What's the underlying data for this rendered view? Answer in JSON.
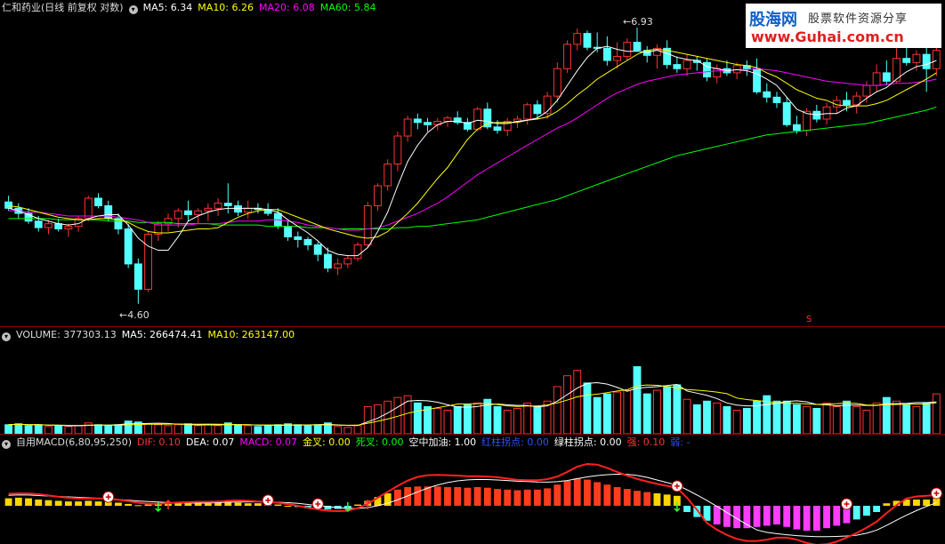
{
  "price_header": {
    "title": "仁和药业(日线 前复权 对数)",
    "ma5": "MA5: 6.34",
    "ma10": "MA10: 6.26",
    "ma20": "MA20: 6.08",
    "ma60": "MA60: 5.84"
  },
  "price_labels": {
    "high": "6.93",
    "low": "4.60",
    "marker": "S"
  },
  "volume_header": {
    "volume": "VOLUME: 377303.13",
    "ma5": "MA5: 266474.41",
    "ma10": "MA10: 263147.00"
  },
  "macd_header": {
    "name": "自用MACD(6,80,95,250)",
    "dif": "DIF: 0.10",
    "dea": "DEA: 0.07",
    "macd": "MACD: 0.07",
    "gold": "金叉: 0.00",
    "death": "死叉: 0.00",
    "refuel": "空中加油: 1.00",
    "red_turn": "红柱拐点: 0.00",
    "green_turn": "绿柱拐点: 0.00",
    "strong": "强: 0.10",
    "weak": "弱: -"
  },
  "watermark": {
    "brand": "股海网",
    "slogan": "股票软件资源分享",
    "url": "www.Guhai.com.cn"
  },
  "colors": {
    "up": "#ff3232",
    "down": "#54ffff",
    "ma5": "#ffffff",
    "ma10": "#ffff00",
    "ma20": "#ff00ff",
    "ma60": "#00ff00",
    "grid": "#8b0000"
  },
  "chart_data": {
    "type": "candlestick",
    "candles": [
      [
        5.35,
        5.4,
        5.28,
        5.3
      ],
      [
        5.3,
        5.34,
        5.22,
        5.26
      ],
      [
        5.26,
        5.3,
        5.18,
        5.2
      ],
      [
        5.2,
        5.24,
        5.12,
        5.15
      ],
      [
        5.15,
        5.21,
        5.1,
        5.18
      ],
      [
        5.18,
        5.22,
        5.12,
        5.14
      ],
      [
        5.14,
        5.18,
        5.08,
        5.16
      ],
      [
        5.16,
        5.24,
        5.12,
        5.22
      ],
      [
        5.22,
        5.4,
        5.2,
        5.38
      ],
      [
        5.38,
        5.42,
        5.3,
        5.32
      ],
      [
        5.32,
        5.36,
        5.2,
        5.22
      ],
      [
        5.22,
        5.26,
        5.1,
        5.14
      ],
      [
        5.14,
        5.18,
        4.85,
        4.88
      ],
      [
        4.88,
        4.92,
        4.6,
        4.7
      ],
      [
        4.7,
        5.12,
        4.68,
        5.1
      ],
      [
        5.1,
        5.2,
        5.05,
        5.18
      ],
      [
        5.18,
        5.26,
        5.12,
        5.22
      ],
      [
        5.22,
        5.3,
        5.15,
        5.28
      ],
      [
        5.28,
        5.36,
        5.2,
        5.25
      ],
      [
        5.25,
        5.3,
        5.18,
        5.28
      ],
      [
        5.28,
        5.34,
        5.2,
        5.3
      ],
      [
        5.3,
        5.38,
        5.24,
        5.34
      ],
      [
        5.34,
        5.5,
        5.26,
        5.32
      ],
      [
        5.32,
        5.36,
        5.24,
        5.27
      ],
      [
        5.27,
        5.36,
        5.22,
        5.3
      ],
      [
        5.3,
        5.34,
        5.26,
        5.29
      ],
      [
        5.29,
        5.34,
        5.24,
        5.26
      ],
      [
        5.26,
        5.3,
        5.14,
        5.16
      ],
      [
        5.16,
        5.2,
        5.05,
        5.08
      ],
      [
        5.08,
        5.12,
        5.0,
        5.06
      ],
      [
        5.06,
        5.08,
        4.98,
        5.02
      ],
      [
        5.02,
        5.04,
        4.9,
        4.95
      ],
      [
        4.95,
        5.0,
        4.82,
        4.85
      ],
      [
        4.85,
        4.92,
        4.8,
        4.88
      ],
      [
        4.88,
        4.94,
        4.85,
        4.92
      ],
      [
        4.92,
        5.04,
        4.9,
        5.02
      ],
      [
        5.02,
        5.35,
        5.0,
        5.32
      ],
      [
        5.32,
        5.5,
        5.28,
        5.48
      ],
      [
        5.48,
        5.7,
        5.44,
        5.66
      ],
      [
        5.66,
        5.94,
        5.6,
        5.9
      ],
      [
        5.9,
        6.08,
        5.85,
        6.05
      ],
      [
        6.05,
        6.1,
        5.96,
        6.02
      ],
      [
        6.02,
        6.06,
        5.94,
        6.0
      ],
      [
        6.0,
        6.06,
        5.95,
        6.03
      ],
      [
        6.03,
        6.08,
        5.98,
        6.06
      ],
      [
        6.06,
        6.12,
        6.0,
        6.02
      ],
      [
        6.02,
        6.06,
        5.94,
        5.96
      ],
      [
        5.96,
        6.16,
        5.94,
        6.14
      ],
      [
        6.14,
        6.2,
        5.96,
        5.98
      ],
      [
        5.98,
        6.04,
        5.92,
        5.95
      ],
      [
        5.95,
        6.06,
        5.9,
        6.03
      ],
      [
        6.03,
        6.08,
        5.97,
        6.05
      ],
      [
        6.05,
        6.2,
        6.0,
        6.18
      ],
      [
        6.18,
        6.22,
        6.05,
        6.1
      ],
      [
        6.1,
        6.3,
        6.05,
        6.26
      ],
      [
        6.26,
        6.58,
        6.2,
        6.52
      ],
      [
        6.52,
        6.8,
        6.48,
        6.76
      ],
      [
        6.76,
        6.92,
        6.7,
        6.87
      ],
      [
        6.87,
        6.9,
        6.7,
        6.73
      ],
      [
        6.73,
        6.88,
        6.68,
        6.72
      ],
      [
        6.72,
        6.84,
        6.55,
        6.6
      ],
      [
        6.6,
        6.78,
        6.52,
        6.64
      ],
      [
        6.64,
        6.82,
        6.6,
        6.78
      ],
      [
        6.78,
        6.93,
        6.7,
        6.7
      ],
      [
        6.7,
        6.74,
        6.58,
        6.65
      ],
      [
        6.65,
        6.76,
        6.52,
        6.72
      ],
      [
        6.72,
        6.8,
        6.52,
        6.56
      ],
      [
        6.56,
        6.64,
        6.48,
        6.52
      ],
      [
        6.52,
        6.66,
        6.45,
        6.6
      ],
      [
        6.6,
        6.64,
        6.5,
        6.58
      ],
      [
        6.58,
        6.62,
        6.4,
        6.44
      ],
      [
        6.44,
        6.56,
        6.38,
        6.52
      ],
      [
        6.52,
        6.6,
        6.45,
        6.48
      ],
      [
        6.48,
        6.58,
        6.42,
        6.55
      ],
      [
        6.55,
        6.6,
        6.45,
        6.52
      ],
      [
        6.52,
        6.62,
        6.28,
        6.3
      ],
      [
        6.3,
        6.38,
        6.2,
        6.25
      ],
      [
        6.25,
        6.3,
        6.15,
        6.2
      ],
      [
        6.2,
        6.25,
        5.98,
        6.0
      ],
      [
        6.0,
        6.08,
        5.92,
        5.95
      ],
      [
        5.95,
        6.15,
        5.9,
        6.12
      ],
      [
        6.12,
        6.18,
        6.02,
        6.05
      ],
      [
        6.05,
        6.2,
        6.0,
        6.16
      ],
      [
        6.16,
        6.26,
        6.1,
        6.22
      ],
      [
        6.22,
        6.3,
        6.12,
        6.18
      ],
      [
        6.18,
        6.3,
        6.1,
        6.26
      ],
      [
        6.26,
        6.4,
        6.2,
        6.36
      ],
      [
        6.36,
        6.56,
        6.3,
        6.48
      ],
      [
        6.48,
        6.6,
        6.36,
        6.4
      ],
      [
        6.4,
        6.72,
        6.38,
        6.62
      ],
      [
        6.62,
        6.82,
        6.55,
        6.58
      ],
      [
        6.58,
        6.7,
        6.5,
        6.66
      ],
      [
        6.66,
        6.74,
        6.3,
        6.52
      ],
      [
        6.52,
        6.76,
        6.45,
        6.7
      ]
    ],
    "ma5": [
      5.3,
      5.28,
      5.25,
      5.22,
      5.2,
      5.18,
      5.17,
      5.18,
      5.22,
      5.24,
      5.25,
      5.25,
      5.17,
      5.07,
      5.01,
      4.98,
      4.98,
      5.08,
      5.2,
      5.24,
      5.27,
      5.29,
      5.3,
      5.3,
      5.3,
      5.3,
      5.29,
      5.27,
      5.21,
      5.16,
      5.11,
      5.05,
      4.98,
      4.95,
      4.94,
      4.94,
      5.0,
      5.12,
      5.27,
      5.48,
      5.68,
      5.82,
      5.93,
      6.0,
      6.03,
      6.03,
      6.01,
      6.04,
      6.03,
      6.01,
      6.01,
      6.03,
      6.04,
      6.06,
      6.12,
      6.22,
      6.36,
      6.5,
      6.63,
      6.72,
      6.74,
      6.71,
      6.69,
      6.69,
      6.68,
      6.7,
      6.67,
      6.63,
      6.61,
      6.6,
      6.54,
      6.52,
      6.5,
      6.51,
      6.5,
      6.47,
      6.42,
      6.36,
      6.25,
      6.14,
      6.1,
      6.09,
      6.1,
      6.1,
      6.15,
      6.17,
      6.24,
      6.3,
      6.34,
      6.42,
      6.49,
      6.54,
      6.56,
      6.6
    ],
    "ma10": [
      5.32,
      5.31,
      5.29,
      5.27,
      5.25,
      5.23,
      5.22,
      5.21,
      5.21,
      5.22,
      5.22,
      5.21,
      5.19,
      5.15,
      5.12,
      5.11,
      5.11,
      5.12,
      5.13,
      5.14,
      5.14,
      5.15,
      5.19,
      5.23,
      5.26,
      5.28,
      5.29,
      5.29,
      5.26,
      5.23,
      5.2,
      5.17,
      5.14,
      5.12,
      5.1,
      5.08,
      5.07,
      5.08,
      5.12,
      5.19,
      5.26,
      5.34,
      5.44,
      5.54,
      5.63,
      5.75,
      5.87,
      5.96,
      6.01,
      6.02,
      6.02,
      6.02,
      6.04,
      6.05,
      6.07,
      6.12,
      6.19,
      6.27,
      6.34,
      6.42,
      6.48,
      6.54,
      6.6,
      6.66,
      6.7,
      6.71,
      6.7,
      6.68,
      6.66,
      6.64,
      6.62,
      6.6,
      6.58,
      6.56,
      6.55,
      6.53,
      6.48,
      6.44,
      6.38,
      6.32,
      6.28,
      6.24,
      6.22,
      6.18,
      6.17,
      6.17,
      6.17,
      6.19,
      6.22,
      6.27,
      6.32,
      6.37,
      6.42,
      6.48
    ],
    "ma20": [
      5.28,
      5.28,
      5.27,
      5.27,
      5.26,
      5.25,
      5.24,
      5.24,
      5.24,
      5.24,
      5.24,
      5.23,
      5.22,
      5.21,
      5.19,
      5.17,
      5.17,
      5.17,
      5.17,
      5.18,
      5.18,
      5.18,
      5.19,
      5.2,
      5.2,
      5.2,
      5.21,
      5.21,
      5.2,
      5.19,
      5.17,
      5.16,
      5.15,
      5.14,
      5.13,
      5.13,
      5.14,
      5.15,
      5.17,
      5.2,
      5.23,
      5.26,
      5.3,
      5.34,
      5.39,
      5.45,
      5.51,
      5.57,
      5.62,
      5.67,
      5.72,
      5.77,
      5.82,
      5.87,
      5.92,
      5.97,
      6.01,
      6.06,
      6.12,
      6.18,
      6.24,
      6.29,
      6.33,
      6.37,
      6.4,
      6.42,
      6.44,
      6.46,
      6.47,
      6.48,
      6.49,
      6.5,
      6.5,
      6.51,
      6.51,
      6.52,
      6.51,
      6.5,
      6.48,
      6.46,
      6.44,
      6.42,
      6.4,
      6.39,
      6.38,
      6.37,
      6.36,
      6.36,
      6.37,
      6.38,
      6.38,
      6.39,
      6.4,
      6.42
    ],
    "ma60": [
      5.22,
      5.22,
      5.22,
      5.22,
      5.22,
      5.21,
      5.21,
      5.21,
      5.21,
      5.21,
      5.2,
      5.2,
      5.2,
      5.19,
      5.19,
      5.19,
      5.19,
      5.18,
      5.18,
      5.18,
      5.18,
      5.17,
      5.17,
      5.17,
      5.17,
      5.17,
      5.16,
      5.16,
      5.16,
      5.16,
      5.15,
      5.15,
      5.15,
      5.14,
      5.14,
      5.14,
      5.14,
      5.14,
      5.14,
      5.15,
      5.15,
      5.16,
      5.16,
      5.17,
      5.18,
      5.19,
      5.2,
      5.21,
      5.23,
      5.25,
      5.27,
      5.29,
      5.31,
      5.33,
      5.35,
      5.37,
      5.4,
      5.43,
      5.46,
      5.49,
      5.52,
      5.55,
      5.58,
      5.61,
      5.64,
      5.67,
      5.7,
      5.73,
      5.75,
      5.77,
      5.79,
      5.81,
      5.83,
      5.85,
      5.87,
      5.89,
      5.91,
      5.92,
      5.93,
      5.94,
      5.95,
      5.96,
      5.97,
      5.98,
      5.99,
      6.0,
      6.01,
      6.03,
      6.05,
      6.07,
      6.09,
      6.11,
      6.13,
      6.16
    ],
    "volume": [
      0.1,
      0.11,
      0.09,
      0.1,
      0.08,
      0.09,
      0.08,
      0.09,
      0.12,
      0.1,
      0.09,
      0.1,
      0.14,
      0.13,
      0.11,
      0.1,
      0.09,
      0.1,
      0.11,
      0.09,
      0.1,
      0.09,
      0.12,
      0.1,
      0.09,
      0.08,
      0.09,
      0.1,
      0.11,
      0.1,
      0.09,
      0.1,
      0.12,
      0.08,
      0.07,
      0.09,
      0.3,
      0.32,
      0.36,
      0.4,
      0.42,
      0.34,
      0.3,
      0.28,
      0.26,
      0.3,
      0.32,
      0.34,
      0.38,
      0.3,
      0.26,
      0.28,
      0.34,
      0.3,
      0.36,
      0.52,
      0.64,
      0.7,
      0.56,
      0.4,
      0.44,
      0.46,
      0.48,
      0.74,
      0.44,
      0.48,
      0.52,
      0.54,
      0.38,
      0.32,
      0.36,
      0.34,
      0.3,
      0.26,
      0.28,
      0.36,
      0.42,
      0.36,
      0.36,
      0.32,
      0.3,
      0.28,
      0.34,
      0.3,
      0.36,
      0.3,
      0.26,
      0.34,
      0.4,
      0.36,
      0.32,
      0.3,
      0.34,
      0.44
    ],
    "macd": [
      0.012,
      0.013,
      0.012,
      0.01,
      0.009,
      0.008,
      0.007,
      0.007,
      0.008,
      0.007,
      0.006,
      0.005,
      0.003,
      0.001,
      0.002,
      0.003,
      0.003,
      0.004,
      0.004,
      0.004,
      0.004,
      0.005,
      0.006,
      0.005,
      0.004,
      0.004,
      0.003,
      0.002,
      0.0,
      -0.002,
      -0.004,
      -0.005,
      -0.006,
      -0.005,
      -0.004,
      0.002,
      0.008,
      0.014,
      0.02,
      0.026,
      0.03,
      0.031,
      0.031,
      0.031,
      0.03,
      0.03,
      0.029,
      0.03,
      0.029,
      0.027,
      0.026,
      0.025,
      0.026,
      0.026,
      0.028,
      0.034,
      0.04,
      0.044,
      0.042,
      0.038,
      0.034,
      0.03,
      0.027,
      0.024,
      0.022,
      0.02,
      0.018,
      0.016,
      -0.01,
      -0.018,
      -0.024,
      -0.03,
      -0.034,
      -0.036,
      -0.036,
      -0.034,
      -0.032,
      -0.03,
      -0.034,
      -0.038,
      -0.04,
      -0.04,
      -0.036,
      -0.032,
      -0.028,
      -0.022,
      -0.016,
      -0.01,
      0.004,
      0.008,
      0.01,
      0.01,
      0.01,
      0.012
    ]
  }
}
